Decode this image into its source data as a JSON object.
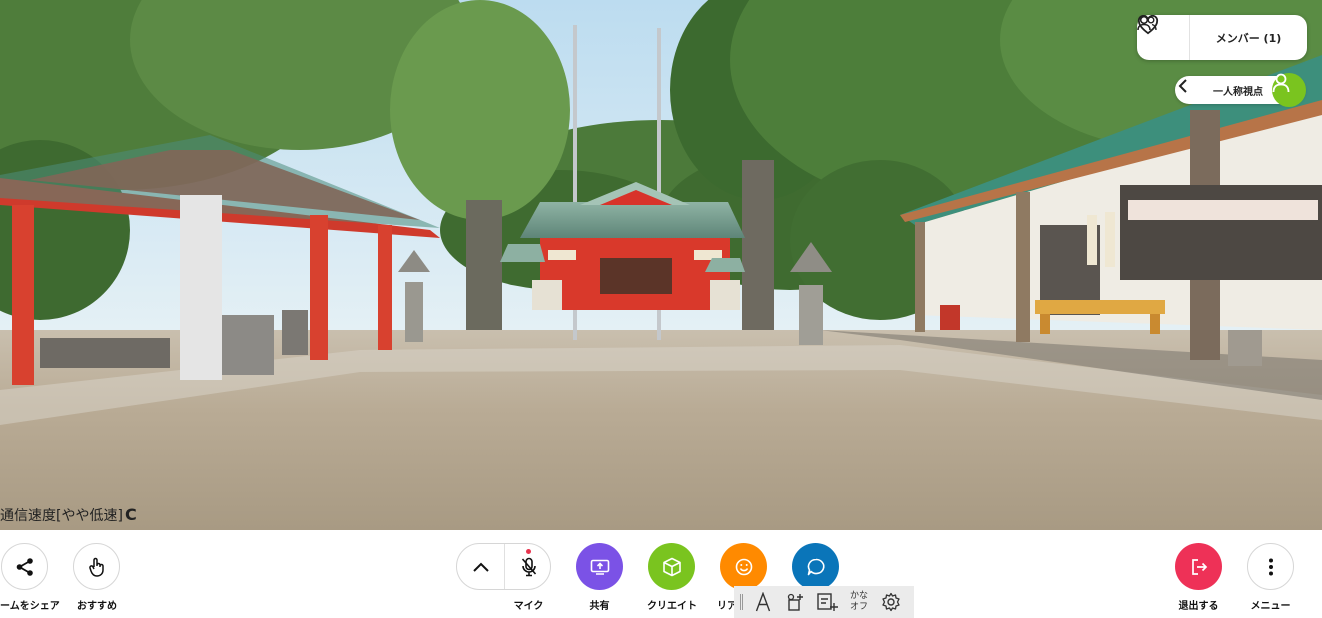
{
  "status": {
    "network": "通信速度[やや低速]",
    "reload": "C"
  },
  "top_right": {
    "members_label": "メンバー (1)",
    "pov_label": "一人称視点"
  },
  "bottom_bar": {
    "share_room": "ームをシェア",
    "recommend": "おすすめ",
    "mic": "マイク",
    "share": "共有",
    "create": "クリエイト",
    "reaction": "リア",
    "exit": "退出する",
    "menu": "メニュー"
  },
  "toolbox": {
    "kana_line1": "かな",
    "kana_line2": "オフ"
  },
  "colors": {
    "share_button": "#7b52e6",
    "create_button": "#7ac41f",
    "reaction_button": "#ff8a00",
    "chat_button": "#0a75b9",
    "exit_button": "#ee3157",
    "avatar": "#7ac41f"
  },
  "icons": {
    "share_room": "share-icon",
    "recommend": "hand-pointer-icon",
    "expand": "chevron-up-icon",
    "mic": "mic-off-icon",
    "share": "screen-share-icon",
    "create": "cube-icon",
    "reaction": "smile-icon",
    "chat": "chat-bubble-icon",
    "exit": "exit-icon",
    "menu": "more-vertical-icon",
    "favorite": "heart-icon",
    "members": "people-icon",
    "pov_back": "chevron-left-icon",
    "pov_avatar": "person-icon",
    "font": "font-size-icon",
    "object": "add-object-icon",
    "board": "add-board-icon",
    "settings": "gear-icon"
  }
}
